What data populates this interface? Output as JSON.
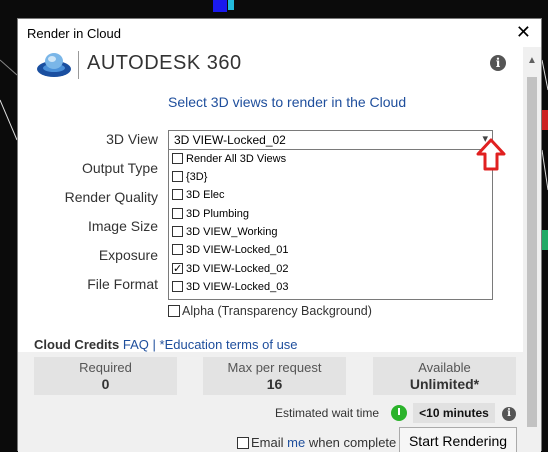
{
  "window": {
    "title": "Render in Cloud",
    "close_glyph": "✕"
  },
  "brand": {
    "name": "AUTODESK",
    "suffix": "360",
    "info_glyph": "i"
  },
  "subtitle": "Select 3D views to render in the Cloud",
  "labels": {
    "view": "3D View",
    "output_type": "Output Type",
    "render_quality": "Render Quality",
    "image_size": "Image Size",
    "exposure": "Exposure",
    "file_format": "File Format"
  },
  "view_dropdown": {
    "value": "3D VIEW-Locked_02",
    "chevron": "▾",
    "options": [
      {
        "label": "Render All 3D Views",
        "checked": false
      },
      {
        "label": "{3D}",
        "checked": false
      },
      {
        "label": "3D Elec",
        "checked": false
      },
      {
        "label": "3D Plumbing",
        "checked": false
      },
      {
        "label": "3D VIEW_Working",
        "checked": false
      },
      {
        "label": "3D VIEW-Locked_01",
        "checked": false
      },
      {
        "label": "3D VIEW-Locked_02",
        "checked": true
      },
      {
        "label": "3D VIEW-Locked_03",
        "checked": false
      }
    ]
  },
  "alpha": {
    "label": "Alpha (Transparency Background)",
    "checked": false
  },
  "credits": {
    "title": "Cloud Credits",
    "faq": "FAQ",
    "separator": "|",
    "edu": "*Education terms of use",
    "required": {
      "label": "Required",
      "value": "0"
    },
    "max": {
      "label": "Max per request",
      "value": "16"
    },
    "available": {
      "label": "Available",
      "value": "Unlimited*"
    }
  },
  "wait": {
    "label": "Estimated wait time",
    "value": "<10 minutes",
    "info_glyph": "i"
  },
  "email": {
    "prefix": "Email",
    "me": "me",
    "suffix": "when complete",
    "checked": false
  },
  "start_button": "Start Rendering",
  "colors": {
    "accent": "#1e4e9c",
    "annotation_arrow": "#e02020",
    "status_green": "#2bb32b"
  }
}
